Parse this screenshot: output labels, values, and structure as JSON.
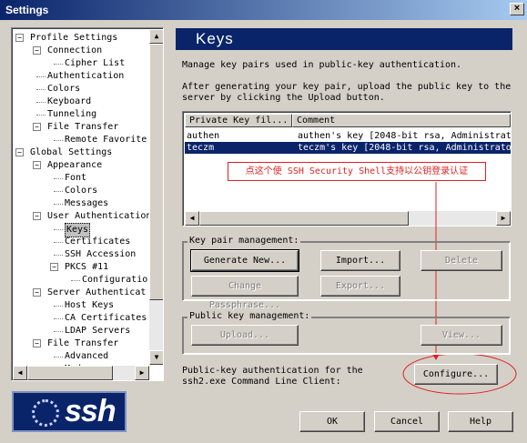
{
  "window": {
    "title": "Settings",
    "close_glyph": "×"
  },
  "tree": {
    "items": [
      {
        "label": "Profile Settings",
        "expander": "−"
      },
      {
        "label": "Connection",
        "expander": "−"
      },
      {
        "label": "Cipher List"
      },
      {
        "label": "Authentication"
      },
      {
        "label": "Colors"
      },
      {
        "label": "Keyboard"
      },
      {
        "label": "Tunneling"
      },
      {
        "label": "File Transfer",
        "expander": "−"
      },
      {
        "label": "Remote Favorite"
      },
      {
        "label": "Global Settings",
        "expander": "−"
      },
      {
        "label": "Appearance",
        "expander": "−"
      },
      {
        "label": "Font"
      },
      {
        "label": "Colors"
      },
      {
        "label": "Messages"
      },
      {
        "label": "User Authentication",
        "expander": "−"
      },
      {
        "label": "Keys"
      },
      {
        "label": "Certificates"
      },
      {
        "label": "SSH Accession"
      },
      {
        "label": "PKCS #11",
        "expander": "−"
      },
      {
        "label": "Configuratio"
      },
      {
        "label": "Server Authenticat",
        "expander": "−"
      },
      {
        "label": "Host Keys"
      },
      {
        "label": "CA Certificates"
      },
      {
        "label": "LDAP Servers"
      },
      {
        "label": "File Transfer",
        "expander": "−"
      },
      {
        "label": "Advanced"
      },
      {
        "label": "Mode"
      }
    ],
    "selected": "Keys"
  },
  "scroll_arrows": {
    "up": "▲",
    "down": "▼",
    "left": "◀",
    "right": "▶"
  },
  "logo": {
    "text": "ssh"
  },
  "panel": {
    "title": "Keys",
    "description": "Manage key pairs used in public-key authentication.",
    "instructions_line1": "After generating your key pair, upload the public key to the",
    "instructions_line2": "server by clicking the Upload button."
  },
  "key_list": {
    "columns": [
      "Private Key fil...",
      "Comment"
    ],
    "rows": [
      {
        "file": "authen",
        "comment": "authen's key [2048-bit rsa, Administrat",
        "selected": false
      },
      {
        "file": "teczm",
        "comment": "teczm's key [2048-bit rsa, Administrato",
        "selected": true
      }
    ]
  },
  "annotation": {
    "text": "点这个使 SSH Security Shell支持以公钥登录认证",
    "color": "#e02020"
  },
  "key_pair_group": {
    "label": "Key pair management:",
    "generate": "Generate New...",
    "import": "Import...",
    "delete": "Delete",
    "change_passphrase": "Change Passphrase...",
    "export": "Export..."
  },
  "public_key_group": {
    "label": "Public key management:",
    "upload": "Upload...",
    "view": "View..."
  },
  "cmdline": {
    "line1": "Public-key authentication for the",
    "line2": "ssh2.exe Command Line Client:",
    "configure": "Configure..."
  },
  "footer": {
    "ok": "OK",
    "cancel": "Cancel",
    "help": "Help"
  },
  "colors": {
    "title_blue": "#0a246a",
    "dialog_gray": "#d4d0c8"
  }
}
